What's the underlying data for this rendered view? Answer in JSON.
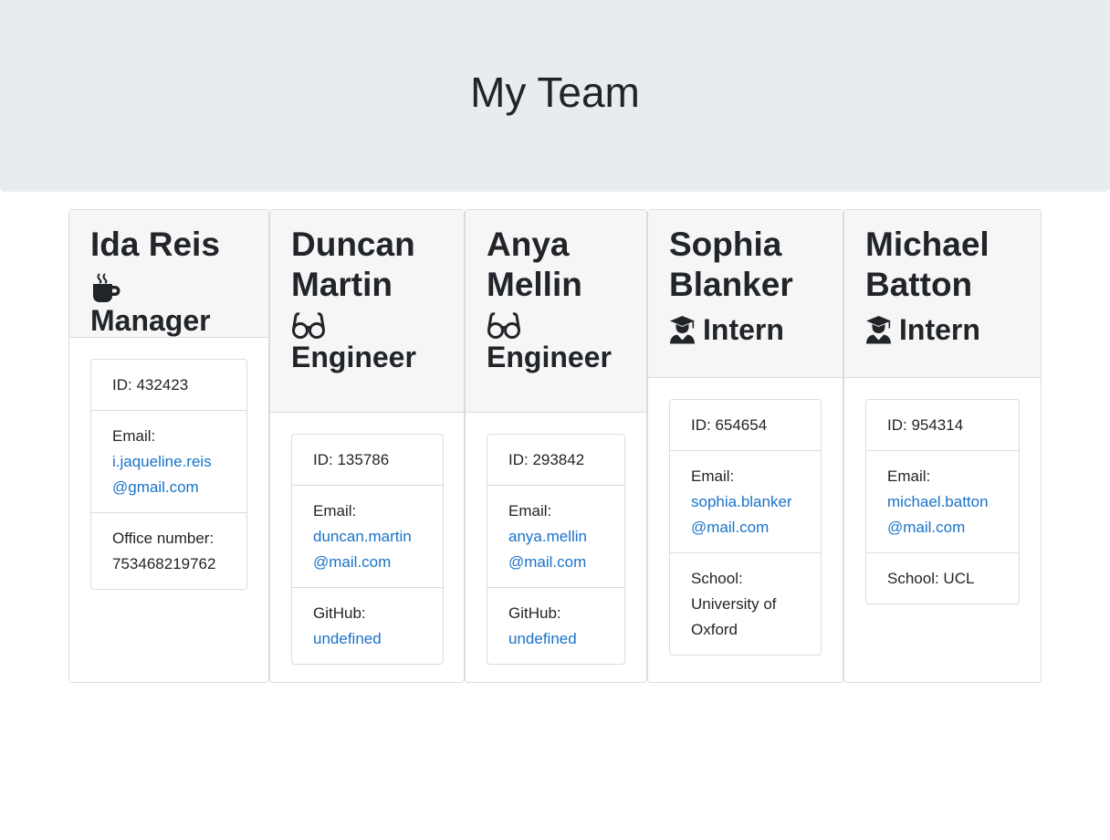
{
  "header": {
    "title": "My Team"
  },
  "members": [
    {
      "name_line1": "Ida Reis",
      "name_line2": "",
      "role": "Manager",
      "icon": "mug-hot-icon",
      "id": "ID: 432423",
      "email_label": "Email:",
      "email_line1": "i.jaqueline.reis",
      "email_line2": "@gmail.com",
      "extra_label": "Office number:",
      "extra_value": "753468219762"
    },
    {
      "name_line1": "Duncan",
      "name_line2": "Martin",
      "role": "Engineer",
      "icon": "glasses-icon",
      "id": "ID: 135786",
      "email_label": "Email:",
      "email_line1": "duncan.martin",
      "email_line2": "@mail.com",
      "extra_label": "GitHub:",
      "extra_value": "undefined"
    },
    {
      "name_line1": "Anya",
      "name_line2": "Mellin",
      "role": "Engineer",
      "icon": "glasses-icon",
      "id": "ID: 293842",
      "email_label": "Email:",
      "email_line1": "anya.mellin",
      "email_line2": "@mail.com",
      "extra_label": "GitHub:",
      "extra_value": "undefined"
    },
    {
      "name_line1": "Sophia",
      "name_line2": "Blanker",
      "role": "Intern",
      "icon": "user-graduate-icon",
      "id": "ID: 654654",
      "email_label": "Email:",
      "email_line1": "sophia.blanker",
      "email_line2": "@mail.com",
      "extra_label": "School:",
      "extra_value_lines": [
        "University of",
        "Oxford"
      ]
    },
    {
      "name_line1": "Michael",
      "name_line2": "Batton",
      "role": "Intern",
      "icon": "user-graduate-icon",
      "id": "ID: 954314",
      "email_label": "Email:",
      "email_line1": "michael.batton",
      "email_line2": "@mail.com",
      "extra_text": "School: UCL"
    }
  ],
  "colors": {
    "jumbotron": "#e9ecef",
    "link": "#1a73c9",
    "header_bg": "#f6f6f6"
  }
}
